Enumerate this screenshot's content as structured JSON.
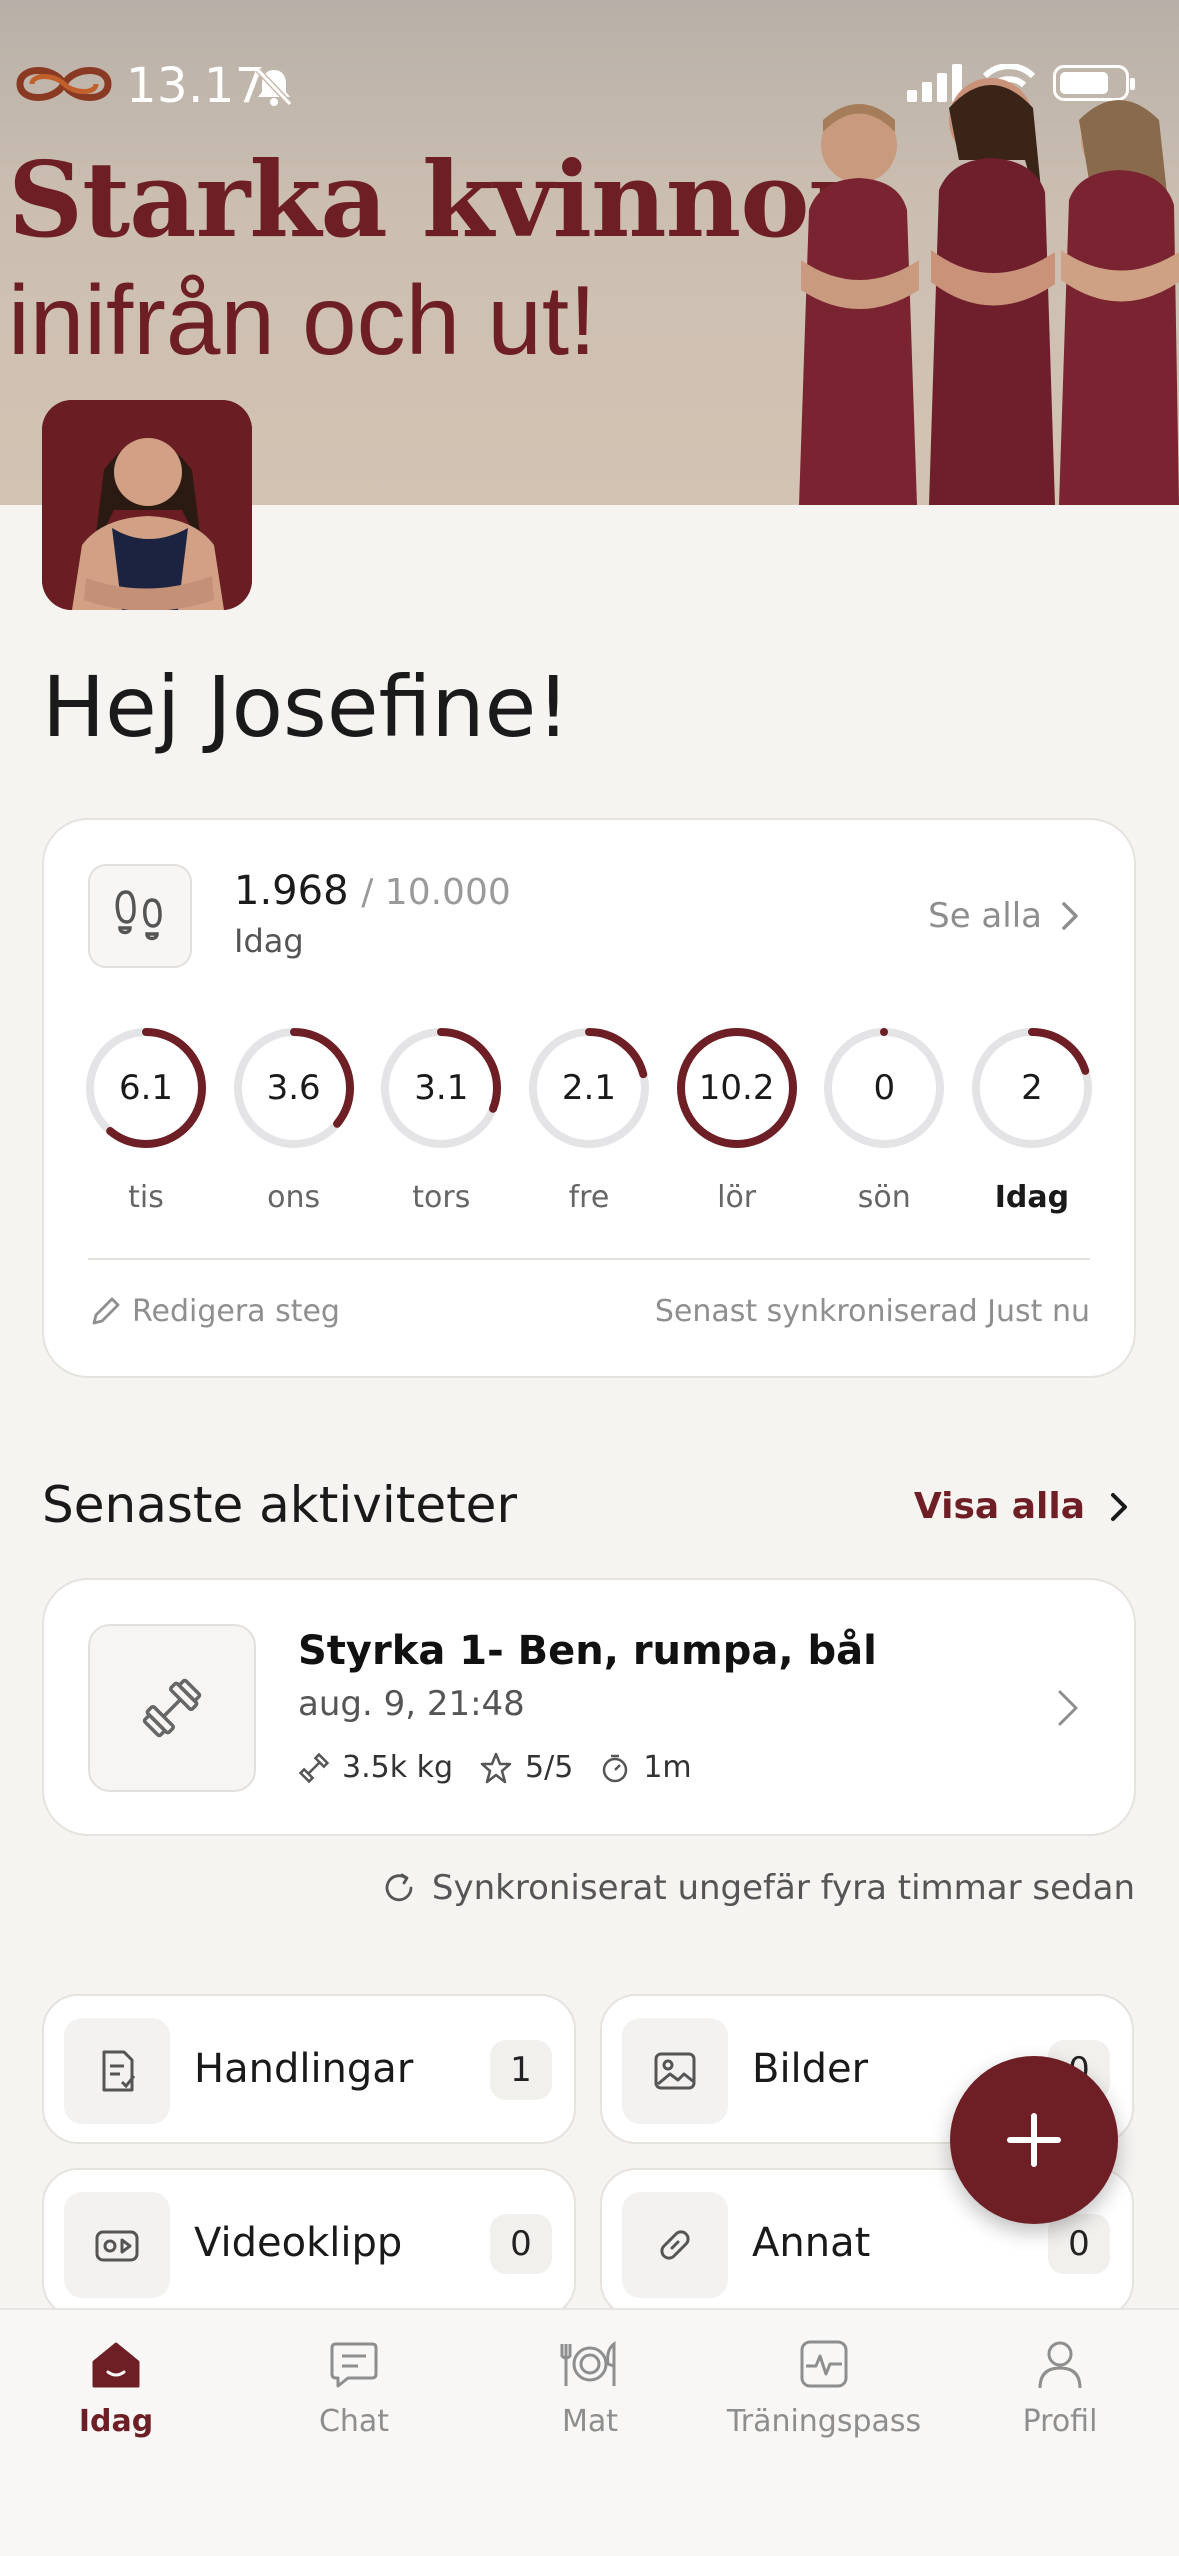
{
  "status": {
    "time": "13.17"
  },
  "banner": {
    "title": "Starka kvinnor",
    "subtitle": "inifrån och ut!"
  },
  "greeting": "Hej Josefine!",
  "steps": {
    "count": "1.968",
    "goal": "/ 10.000",
    "period": "Idag",
    "see_all": "Se alla",
    "days": [
      {
        "value": "6.1",
        "label": "tis",
        "progress": 0.61
      },
      {
        "value": "3.6",
        "label": "ons",
        "progress": 0.36
      },
      {
        "value": "3.1",
        "label": "tors",
        "progress": 0.31
      },
      {
        "value": "2.1",
        "label": "fre",
        "progress": 0.21
      },
      {
        "value": "10.2",
        "label": "lör",
        "progress": 1.0
      },
      {
        "value": "0",
        "label": "sön",
        "progress": 0.0
      },
      {
        "value": "2",
        "label": "Idag",
        "progress": 0.2
      }
    ],
    "edit": "Redigera steg",
    "synced": "Senast synkroniserad Just nu"
  },
  "recent": {
    "title": "Senaste aktiviteter",
    "view_all": "Visa alla",
    "item": {
      "title": "Styrka 1- Ben, rumpa, bål",
      "date": "aug. 9, 21:48",
      "weight": "3.5k kg",
      "rating": "5/5",
      "duration": "1m"
    },
    "sync": "Synkroniserat ungefär fyra timmar sedan"
  },
  "tiles": [
    {
      "label": "Handlingar",
      "count": "1",
      "icon": "document-icon"
    },
    {
      "label": "Bilder",
      "count": "0",
      "icon": "image-icon"
    },
    {
      "label": "Videoklipp",
      "count": "0",
      "icon": "video-icon"
    },
    {
      "label": "Annat",
      "count": "0",
      "icon": "link-icon"
    }
  ],
  "nav": [
    {
      "label": "Idag",
      "icon": "home-icon",
      "active": true
    },
    {
      "label": "Chat",
      "icon": "chat-icon"
    },
    {
      "label": "Mat",
      "icon": "food-icon"
    },
    {
      "label": "Träningspass",
      "icon": "activity-icon"
    },
    {
      "label": "Profil",
      "icon": "profile-icon"
    }
  ],
  "colors": {
    "accent": "#6e1f25",
    "ring_track": "#e4e4e6"
  }
}
